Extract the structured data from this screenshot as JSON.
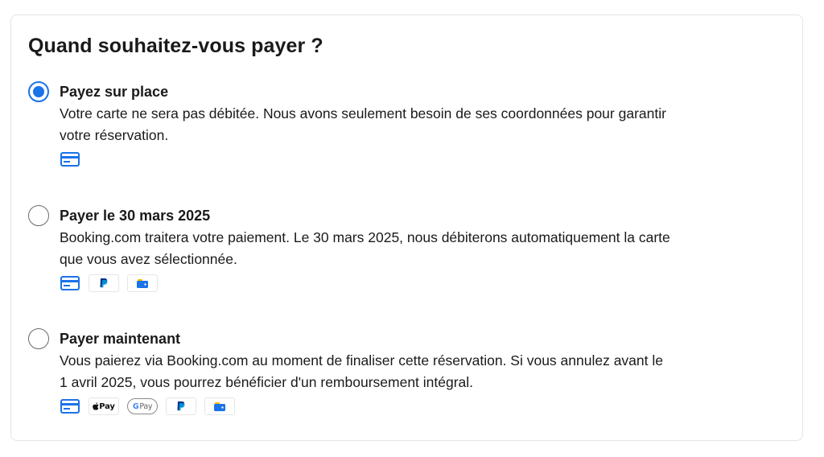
{
  "heading": "Quand souhaitez-vous payer ?",
  "colors": {
    "accent": "#1a73e8",
    "text": "#1a1a1a",
    "border": "#e4e4e4"
  },
  "options": [
    {
      "title": "Payez sur place",
      "selected": true,
      "description_lines": [
        "Votre carte ne sera pas débitée. Nous avons seulement besoin de ses coordonnées pour garantir",
        "votre réservation."
      ],
      "payment_icons": [
        "credit-card-icon"
      ]
    },
    {
      "title": "Payer le 30 mars 2025",
      "selected": false,
      "description_lines": [
        "Booking.com traitera votre paiement. Le 30 mars 2025, nous débiterons automatiquement la carte",
        "que vous avez sélectionnée."
      ],
      "payment_icons": [
        "credit-card-icon",
        "paypal-icon",
        "wallet-icon"
      ]
    },
    {
      "title": "Payer maintenant",
      "selected": false,
      "description_lines": [
        "Vous paierez via Booking.com au moment de finaliser cette réservation. Si vous annulez avant le",
        "1 avril 2025, vous pourrez bénéficier d'un remboursement intégral."
      ],
      "payment_icons": [
        "credit-card-icon",
        "apple-pay-icon",
        "google-pay-icon",
        "paypal-icon",
        "wallet-icon"
      ]
    }
  ],
  "badge_text": {
    "apple_pay": "Pay",
    "google_pay_g": "G",
    "google_pay": "Pay"
  }
}
